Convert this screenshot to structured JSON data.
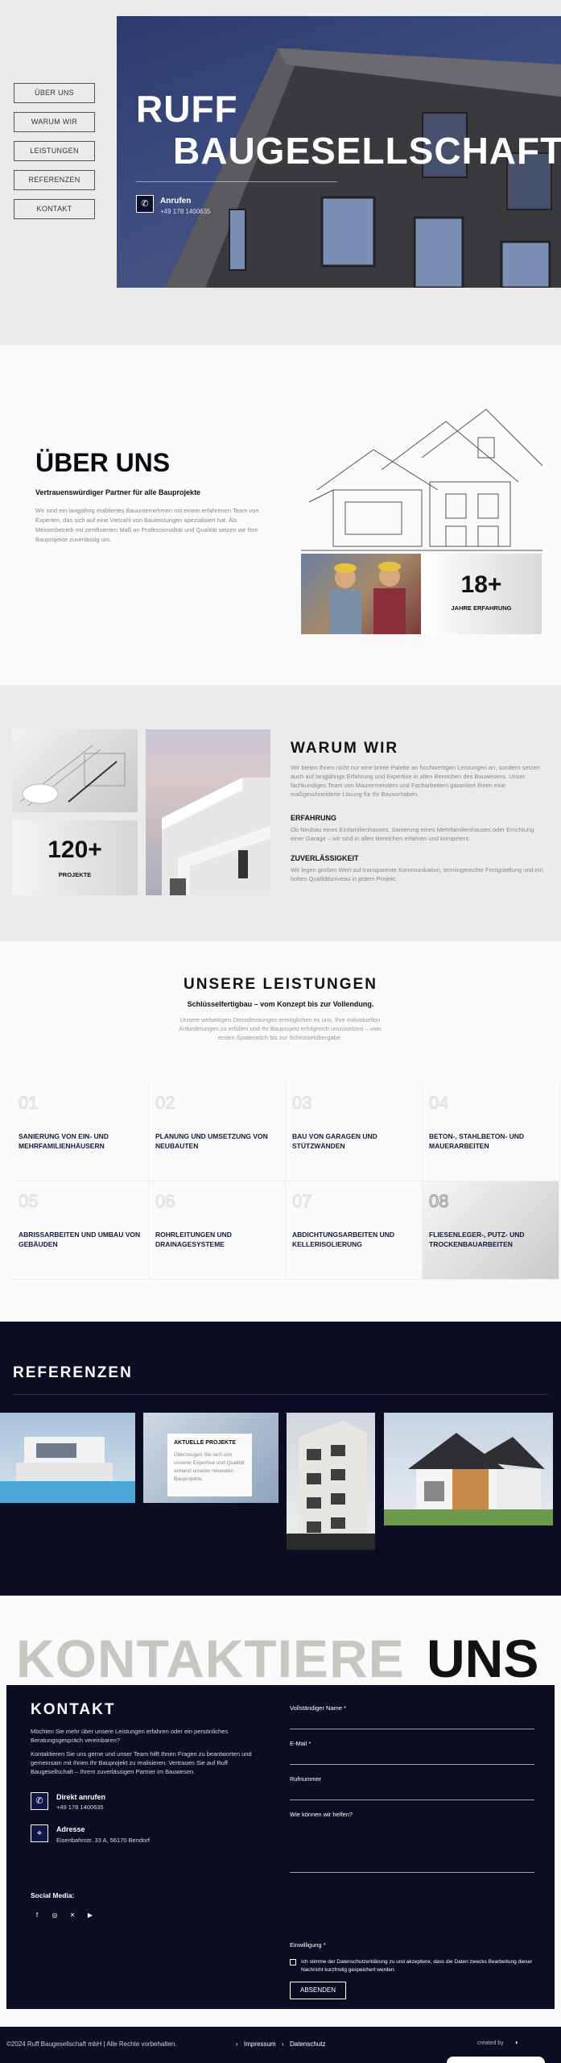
{
  "nav": [
    "ÜBER UNS",
    "WARUM WIR",
    "LEISTUNGEN",
    "REFERENZEN",
    "KONTAKT"
  ],
  "hero": {
    "title_line1": "RUFF",
    "title_line2": "BAUGESELLSCHAFT",
    "call_label": "Anrufen",
    "call_number": "+49 178 1400635"
  },
  "about": {
    "heading": "ÜBER UNS",
    "subheading": "Vertrauenswürdiger Partner für alle Bauprojekte",
    "text": "Wir sind ein langjährig etabliertes Bauunternehmen mit einem erfahrenen Team von Experten, das sich auf eine Vielzahl von Bauleistungen spezialisiert hat. Als Meisterbetrieb mit zertifizierten Maß an Professionalität und Qualität setzen wir Ihre Bauprojekte zuverlässig um.",
    "stat_value": "18+",
    "stat_label": "JAHRE ERFAHRUNG"
  },
  "why": {
    "stat_value": "120+",
    "stat_label": "PROJEKTE",
    "heading": "WARUM WIR",
    "intro": "Wir bieten Ihnen nicht nur eine breite Palette an hochwertigen Leistungen an, sondern setzen auch auf langjährige Erfahrung und Expertise in allen Bereichen des Bauwesens. Unser fachkundiges Team von Maurermeistern und Facharbeitern garantiert Ihnen eine maßgeschneiderte Lösung für Ihr Bauvorhaben.",
    "points": [
      {
        "title": "ERFAHRUNG",
        "text": "Ob Neubau eines Einfamilienhauses, Sanierung eines Mehrfamilienhauses oder Errichtung einer Garage – wir sind in allen Bereichen erfahren und kompetent."
      },
      {
        "title": "ZUVERLÄSSIGKEIT",
        "text": "Wir legen großen Wert auf transparente Kommunikation, termingerechte Fertigstellung und ein hohes Qualitätsniveau in jedem Projekt."
      }
    ]
  },
  "services": {
    "heading": "UNSERE LEISTUNGEN",
    "subheading": "Schlüsselfertigbau – vom Konzept bis zur Vollendung.",
    "text": "Unsere vielseitigen Dienstleistungen ermöglichen es uns, Ihre individuellen Anforderungen zu erfüllen und Ihr Bauprojekt erfolgreich umzusetzen – vom ersten Spatenstich bis zur Schlüsselübergabe.",
    "items": [
      {
        "num": "01",
        "title": "SANIERUNG VON EIN- UND MEHRFAMILIENHÄUSERN"
      },
      {
        "num": "02",
        "title": "PLANUNG UND UMSETZUNG VON NEUBAUTEN"
      },
      {
        "num": "03",
        "title": "BAU VON GARAGEN UND STÜTZWÄNDEN"
      },
      {
        "num": "04",
        "title": "BETON-, STAHLBETON- UND MAUERARBEITEN"
      },
      {
        "num": "05",
        "title": "ABRISSARBEITEN UND UMBAU VON GEBÄUDEN"
      },
      {
        "num": "06",
        "title": "ROHRLEITUNGEN UND DRAINAGESYSTEME"
      },
      {
        "num": "07",
        "title": "ABDICHTUNGSARBEITEN UND KELLERISOLIERUNG"
      },
      {
        "num": "08",
        "title": "FLIESENLEGER-, PUTZ- UND TROCKENBAUARBEITEN"
      }
    ]
  },
  "refs": {
    "heading": "REFERENZEN",
    "card_title": "AKTUELLE PROJEKTE",
    "card_text": "Überzeugen Sie sich von unserer Expertise und Qualität anhand unserer neuesten Bauprojekte."
  },
  "contact": {
    "big_left": "KONTAKTIERE",
    "big_right": "UNS",
    "heading": "KONTAKT",
    "p1": "Möchten Sie mehr über unsere Leistungen erfahren oder ein persönliches Beratungsgespräch vereinbaren?",
    "p2": "Kontaktieren Sie uns gerne und unser Team hilft Ihnen Fragen zu beantworten und gemeinsam mit Ihnen Ihr Bauprojekt zu realisieren. Vertrauen Sie auf Ruff Baugesellschaft – Ihrem zuverlässigen Partner im Bauwesen.",
    "call_label": "Direkt anrufen",
    "call_number": "+49 178 1400635",
    "addr_label": "Adresse",
    "addr_value": "Eisenbahnstr. 33 A, 56170 Bendorf",
    "social_label": "Social Media:",
    "form": {
      "name": "Vollständiger Name *",
      "email": "E-Mail *",
      "phone": "Rufnummer",
      "message": "Wie können wir helfen?",
      "consent_label": "Einwilligung *",
      "consent_text": "Ich stimme der Datenschutzerklärung zu und akzeptiere, dass die Daten zwecks Bearbeitung dieser Nachricht kurzfristig gespeichert werden.",
      "submit": "ABSENDEN"
    }
  },
  "footer": {
    "copyright": "©2024 Ruff Baugesellschaft mbH | Alle Rechte vorbehalten.",
    "impressum": "Impressum",
    "datenschutz": "Datenschutz",
    "credit": "created by"
  },
  "colors": {
    "navy": "#0b0d22",
    "accent": "#141a3c",
    "hero_blue": "#2d3a6d"
  }
}
